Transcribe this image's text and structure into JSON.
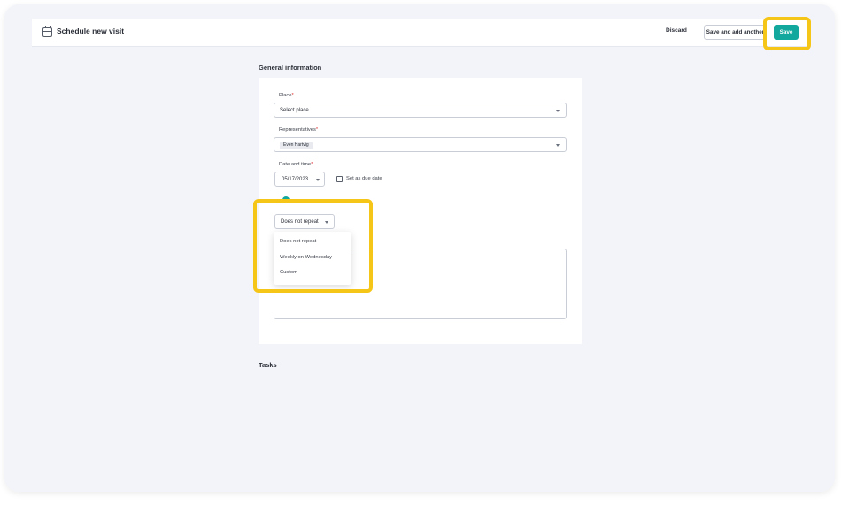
{
  "header": {
    "title": "Schedule new visit",
    "discard_label": "Discard",
    "save_and_add_label": "Save and add another",
    "save_label": "Save"
  },
  "general": {
    "section_title": "General information",
    "place": {
      "label": "Place",
      "required_mark": "*",
      "value": "Select place"
    },
    "representatives": {
      "label": "Representatives",
      "required_mark": "*",
      "chip": "Even Hartvig"
    },
    "datetime": {
      "label": "Date and time",
      "required_mark": "*",
      "date": "05/17/2023",
      "due_label": "Set as due date"
    },
    "repeat": {
      "value": "Does not repeat",
      "options": [
        "Does not repeat",
        "Weekly on Wednesday",
        "Custom"
      ]
    }
  },
  "tasks": {
    "section_title": "Tasks"
  },
  "colors": {
    "accent": "#12a89d",
    "highlight": "#f5c518"
  }
}
